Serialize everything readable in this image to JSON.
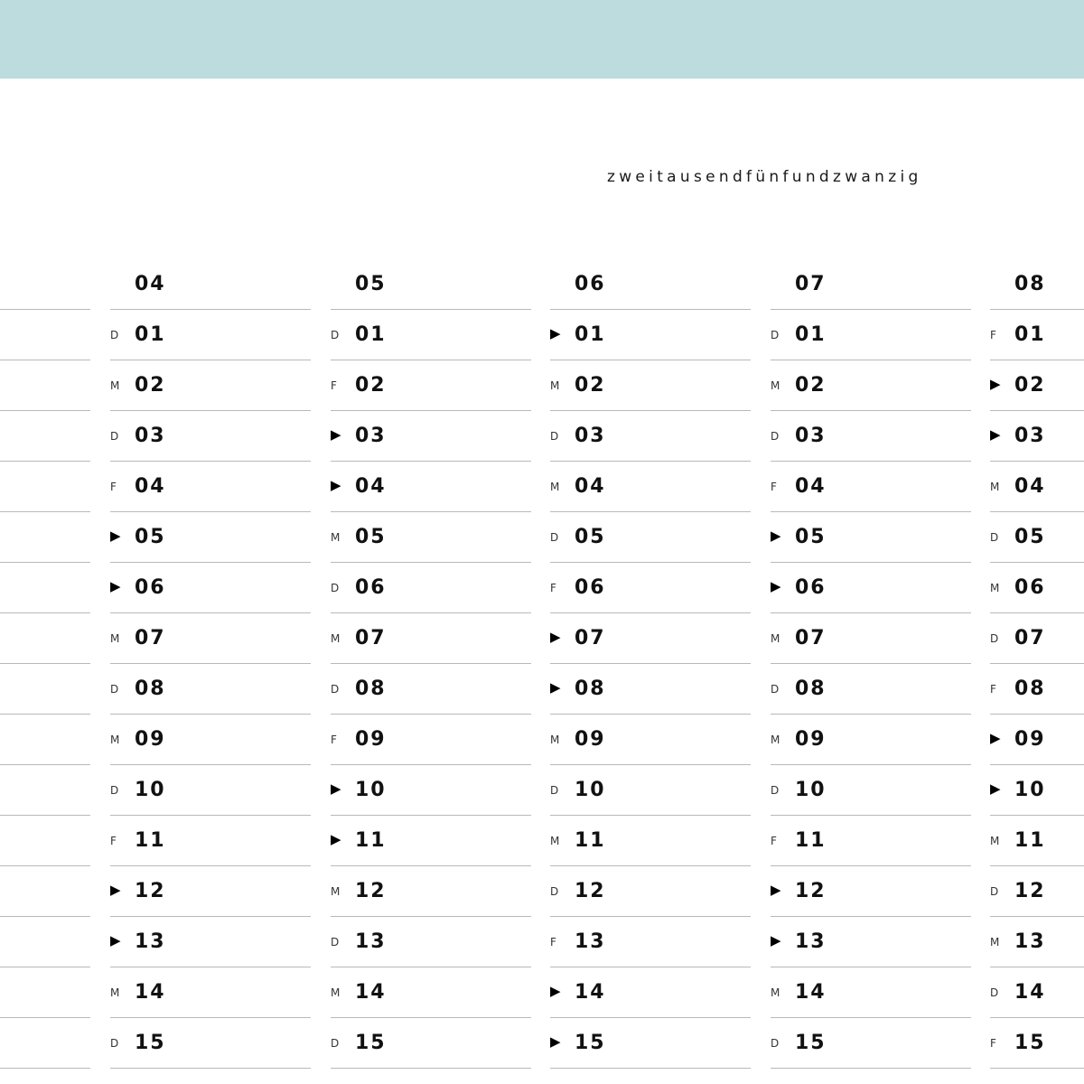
{
  "year_word": "zweitausendfünfundzwanzig",
  "months": [
    {
      "label": "04",
      "days": [
        {
          "wd": "D",
          "num": "01"
        },
        {
          "wd": "M",
          "num": "02"
        },
        {
          "wd": "D",
          "num": "03"
        },
        {
          "wd": "F",
          "num": "04"
        },
        {
          "wd": "▶",
          "num": "05"
        },
        {
          "wd": "▶",
          "num": "06"
        },
        {
          "wd": "M",
          "num": "07"
        },
        {
          "wd": "D",
          "num": "08"
        },
        {
          "wd": "M",
          "num": "09"
        },
        {
          "wd": "D",
          "num": "10"
        },
        {
          "wd": "F",
          "num": "11"
        },
        {
          "wd": "▶",
          "num": "12"
        },
        {
          "wd": "▶",
          "num": "13"
        },
        {
          "wd": "M",
          "num": "14"
        },
        {
          "wd": "D",
          "num": "15"
        }
      ]
    },
    {
      "label": "05",
      "days": [
        {
          "wd": "D",
          "num": "01"
        },
        {
          "wd": "F",
          "num": "02"
        },
        {
          "wd": "▶",
          "num": "03"
        },
        {
          "wd": "▶",
          "num": "04"
        },
        {
          "wd": "M",
          "num": "05"
        },
        {
          "wd": "D",
          "num": "06"
        },
        {
          "wd": "M",
          "num": "07"
        },
        {
          "wd": "D",
          "num": "08"
        },
        {
          "wd": "F",
          "num": "09"
        },
        {
          "wd": "▶",
          "num": "10"
        },
        {
          "wd": "▶",
          "num": "11"
        },
        {
          "wd": "M",
          "num": "12"
        },
        {
          "wd": "D",
          "num": "13"
        },
        {
          "wd": "M",
          "num": "14"
        },
        {
          "wd": "D",
          "num": "15"
        }
      ]
    },
    {
      "label": "06",
      "days": [
        {
          "wd": "▶",
          "num": "01"
        },
        {
          "wd": "M",
          "num": "02"
        },
        {
          "wd": "D",
          "num": "03"
        },
        {
          "wd": "M",
          "num": "04"
        },
        {
          "wd": "D",
          "num": "05"
        },
        {
          "wd": "F",
          "num": "06"
        },
        {
          "wd": "▶",
          "num": "07"
        },
        {
          "wd": "▶",
          "num": "08"
        },
        {
          "wd": "M",
          "num": "09"
        },
        {
          "wd": "D",
          "num": "10"
        },
        {
          "wd": "M",
          "num": "11"
        },
        {
          "wd": "D",
          "num": "12"
        },
        {
          "wd": "F",
          "num": "13"
        },
        {
          "wd": "▶",
          "num": "14"
        },
        {
          "wd": "▶",
          "num": "15"
        }
      ]
    },
    {
      "label": "07",
      "days": [
        {
          "wd": "D",
          "num": "01"
        },
        {
          "wd": "M",
          "num": "02"
        },
        {
          "wd": "D",
          "num": "03"
        },
        {
          "wd": "F",
          "num": "04"
        },
        {
          "wd": "▶",
          "num": "05"
        },
        {
          "wd": "▶",
          "num": "06"
        },
        {
          "wd": "M",
          "num": "07"
        },
        {
          "wd": "D",
          "num": "08"
        },
        {
          "wd": "M",
          "num": "09"
        },
        {
          "wd": "D",
          "num": "10"
        },
        {
          "wd": "F",
          "num": "11"
        },
        {
          "wd": "▶",
          "num": "12"
        },
        {
          "wd": "▶",
          "num": "13"
        },
        {
          "wd": "M",
          "num": "14"
        },
        {
          "wd": "D",
          "num": "15"
        }
      ]
    },
    {
      "label": "08",
      "days": [
        {
          "wd": "F",
          "num": "01"
        },
        {
          "wd": "▶",
          "num": "02"
        },
        {
          "wd": "▶",
          "num": "03"
        },
        {
          "wd": "M",
          "num": "04"
        },
        {
          "wd": "D",
          "num": "05"
        },
        {
          "wd": "M",
          "num": "06"
        },
        {
          "wd": "D",
          "num": "07"
        },
        {
          "wd": "F",
          "num": "08"
        },
        {
          "wd": "▶",
          "num": "09"
        },
        {
          "wd": "▶",
          "num": "10"
        },
        {
          "wd": "M",
          "num": "11"
        },
        {
          "wd": "D",
          "num": "12"
        },
        {
          "wd": "M",
          "num": "13"
        },
        {
          "wd": "D",
          "num": "14"
        },
        {
          "wd": "F",
          "num": "15"
        }
      ]
    }
  ],
  "colors": {
    "band": "#bcdcdd",
    "rule": "#b9b9b9",
    "text": "#111111"
  }
}
